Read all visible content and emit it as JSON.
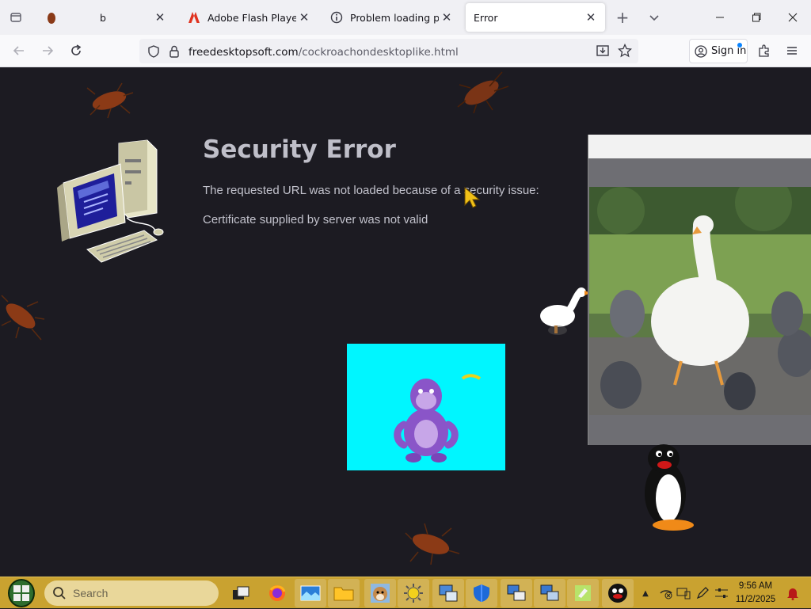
{
  "browser": {
    "tabs": [
      {
        "title": "b",
        "icon": "cockroach-favicon",
        "active": false
      },
      {
        "title": "Adobe Flash Player End",
        "icon": "adobe-icon",
        "active": false
      },
      {
        "title": "Problem loading page",
        "icon": "info-icon",
        "active": false
      },
      {
        "title": "Error",
        "icon": "none",
        "active": true
      }
    ],
    "url": {
      "host": "freedesktopsoft.com",
      "path": "/cockroachondesktoplike.html"
    },
    "sign_in_label": "Sign in"
  },
  "page": {
    "error_title": "Security Error",
    "error_message": "The requested URL was not loaded because of a security issue:",
    "error_detail": "Certificate supplied by server was not valid",
    "colors": {
      "background": "#1c1b22",
      "title": "#bfbfc9",
      "bonzi_box": "#00f6ff"
    }
  },
  "taskbar": {
    "search_placeholder": "Search",
    "time": "9:56 AM",
    "date": "11/2/2025",
    "apps": [
      "task-view-icon",
      "firefox-icon",
      "photos-icon",
      "file-explorer-icon",
      "dog-icon",
      "sun-icon",
      "control-panel-icon",
      "defender-icon",
      "network-icon",
      "monitor-icon",
      "notepad-icon",
      "pingu-icon"
    ]
  }
}
